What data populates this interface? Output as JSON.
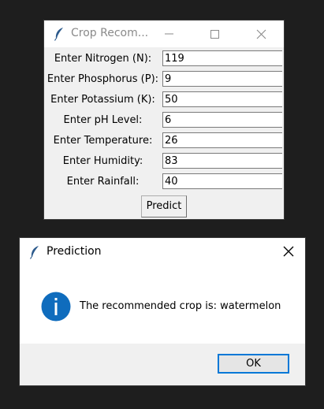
{
  "main_window": {
    "title": "Crop Recom...",
    "fields": [
      {
        "label": "Enter Nitrogen (N):",
        "value": "119"
      },
      {
        "label": "Enter Phosphorus (P):",
        "value": "9"
      },
      {
        "label": "Enter Potassium (K):",
        "value": "50"
      },
      {
        "label": "Enter pH Level:",
        "value": "6"
      },
      {
        "label": "Enter Temperature:",
        "value": "26"
      },
      {
        "label": "Enter Humidity:",
        "value": "83"
      },
      {
        "label": "Enter Rainfall:",
        "value": "40"
      }
    ],
    "predict_label": "Predict"
  },
  "dialog": {
    "title": "Prediction",
    "message": "The recommended crop is: watermelon",
    "ok_label": "OK"
  },
  "colors": {
    "background": "#1e1e1e",
    "info_icon": "#0f6cbd",
    "focus_border": "#0078d7"
  },
  "icons": [
    "feather-icon",
    "minimize-icon",
    "maximize-icon",
    "close-icon",
    "info-icon"
  ]
}
